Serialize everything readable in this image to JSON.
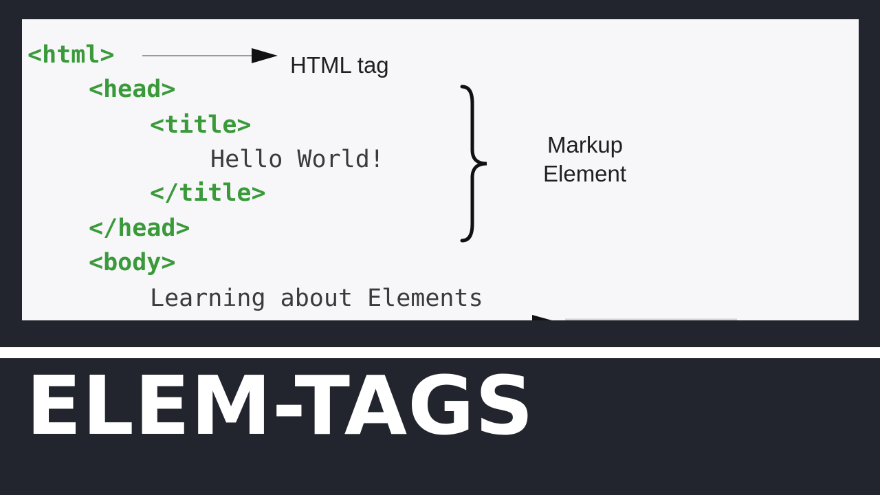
{
  "code": {
    "html_open": "<html>",
    "head_open": "<head>",
    "title_open": "<title>",
    "title_text": "Hello World!",
    "title_close": "</title>",
    "head_close": "</head>",
    "body_open": "<body>",
    "body_text": "Learning about Elements"
  },
  "annotations": {
    "html_tag": "HTML tag",
    "markup_line1": "Markup",
    "markup_line2": "Element"
  },
  "banner": {
    "title": "ELEM-TAGS"
  },
  "colors": {
    "background": "#22252d",
    "panel": "#f7f7fa",
    "tag_green": "#3a9a3a",
    "title_white": "#ffffff"
  }
}
